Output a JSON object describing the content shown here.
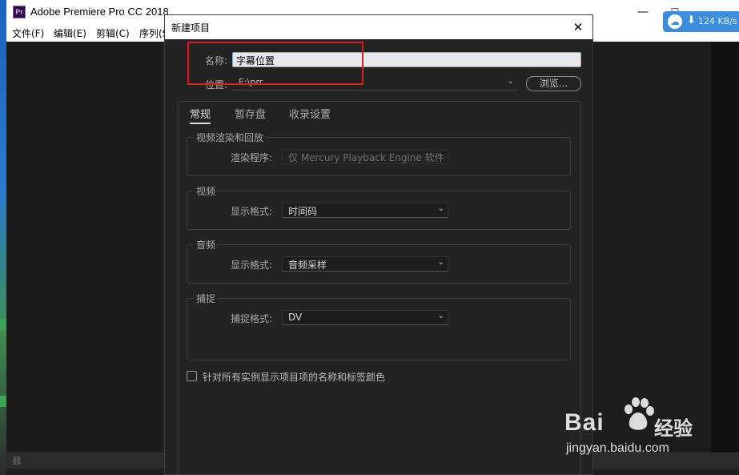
{
  "app": {
    "logo_text": "Pr",
    "title": "Adobe Premiere Pro CC 2018",
    "minimize_glyph": "—",
    "maximize_glyph": "☐",
    "close_glyph": "✕"
  },
  "menu": {
    "items": [
      "文件(F)",
      "编辑(E)",
      "剪辑(C)",
      "序列(S"
    ]
  },
  "net_widget": {
    "arrow": "⬇",
    "speed": "124 KB/s"
  },
  "dialog": {
    "title": "新建项目",
    "close_glyph": "✕",
    "name_label": "名称:",
    "name_value": "字幕位置",
    "location_label": "位置:",
    "location_value": "E:\\prr",
    "browse_label": "浏览...",
    "tabs": [
      {
        "label": "常规",
        "active": true
      },
      {
        "label": "暂存盘",
        "active": false
      },
      {
        "label": "收录设置",
        "active": false
      }
    ],
    "groups": {
      "render": {
        "title": "视频渲染和回放",
        "field_label": "渲染程序:",
        "value": "仅 Mercury Playback Engine 软件"
      },
      "video": {
        "title": "视频",
        "field_label": "显示格式:",
        "value": "时间码"
      },
      "audio": {
        "title": "音频",
        "field_label": "显示格式:",
        "value": "音频采样"
      },
      "capture": {
        "title": "捕捉",
        "field_label": "捕捉格式:",
        "value": "DV"
      }
    },
    "checkbox_label": "针对所有实例显示项目项的名称和标签颜色"
  },
  "watermark": {
    "brand": "Bai",
    "brand_suffix": "经验",
    "url": "jingyan.baidu.com"
  },
  "colors": {
    "highlight_box": "#e0191c",
    "dialog_bg": "#232323",
    "net_widget": "#3d8ddc"
  },
  "icons": {
    "chevron": "chevron-down-icon",
    "cloud": "baidu-cloud-icon",
    "paw": "baidu-paw-icon"
  }
}
